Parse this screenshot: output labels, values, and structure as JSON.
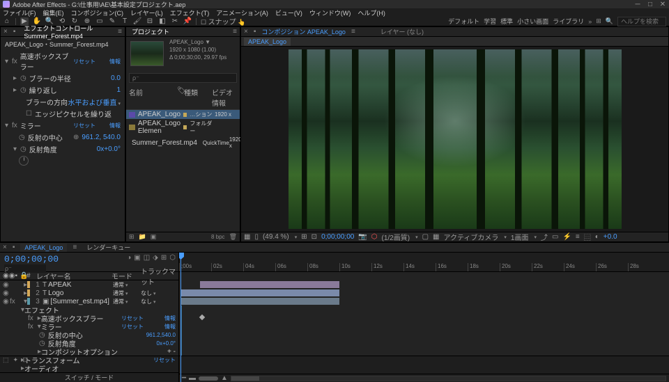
{
  "app": {
    "title": "Adobe After Effects - G:\\仕事用\\AE\\基本設定プロジェクト.aep"
  },
  "menus": [
    "ファイル(F)",
    "編集(E)",
    "コンポジション(C)",
    "レイヤー(L)",
    "エフェクト(T)",
    "アニメーション(A)",
    "ビュー(V)",
    "ウィンドウ(W)",
    "ヘルプ(H)"
  ],
  "toolbar": {
    "snap": "スナップ",
    "workspace_default": "デフォルト",
    "workspace_learn": "学習",
    "workspace_standard": "標準",
    "workspace_small": "小さい画面",
    "workspace_lib": "ライブラリ",
    "search_placeholder": "ヘルプを検索"
  },
  "effects_panel": {
    "tab": "エフェクトコントロール Summer_Forest.mp4",
    "layer": "APEAK_Logo・Summer_Forest.mp4",
    "reset": "リセット",
    "info": "情報",
    "fx1_name": "高速ボックスブラー",
    "fx1_blur_radius_label": "ブラーの半径",
    "fx1_blur_radius_value": "0.0",
    "fx1_iterations_label": "繰り返し",
    "fx1_iterations_value": "1",
    "fx1_direction_label": "ブラーの方向",
    "fx1_direction_value": "水平および垂直",
    "fx1_edge_label": "エッジピクセルを繰り返",
    "fx2_name": "ミラー",
    "fx2_center_label": "反射の中心",
    "fx2_center_value": "961.2, 540.0",
    "fx2_angle_label": "反射角度",
    "fx2_angle_value": "0x+0.0°"
  },
  "project_panel": {
    "tab": "プロジェクト",
    "comp_name": "APEAK_Logo ▼",
    "comp_dims": "1920 x 1080 (1.00)",
    "comp_duration": "Δ 0;00;30;00, 29.97 fps",
    "search_placeholder": "ρ⁻",
    "col_name": "名前",
    "col_type": "種類",
    "col_video": "ビデオ情報",
    "items": [
      {
        "name": "APEAK_Logo",
        "type": "…ション",
        "info": "1920 x"
      },
      {
        "name": "APEAK_Logo Elemen",
        "type": "フォルダー",
        "info": ""
      },
      {
        "name": "Summer_Forest.mp4",
        "type": "QuickTime",
        "info": "1920 x"
      }
    ],
    "bpc": "8 bpc"
  },
  "comp_panel": {
    "tab_comp": "コンポジション APEAK_Logo",
    "tab_layer": "レイヤー (なし)",
    "active_tab": "APEAK_Logo"
  },
  "viewer_footer": {
    "zoom": "(49.4 %)",
    "res_label": "(1/2画質)",
    "time": "0;00;00;00",
    "camera": "アクティブカメラ",
    "views": "1画面",
    "exposure": "+0.0"
  },
  "timeline": {
    "tab_comp": "APEAK_Logo",
    "tab_rq": "レンダーキュー",
    "timecode": "0;00;00;00",
    "search_placeholder": "ρ⁻",
    "col_num": "#",
    "col_layer_name": "レイヤー名",
    "col_mode": "モード",
    "col_trkmat": "トラックマット",
    "mode_normal": "通常",
    "mode_none": "なし",
    "layers": [
      {
        "num": "1",
        "name": "APEAK",
        "color": "#d4a858"
      },
      {
        "num": "2",
        "name": "Logo",
        "color": "#d4a858"
      },
      {
        "num": "3",
        "name": "[Summer_est.mp4]",
        "color": "#5a9aaa"
      }
    ],
    "fx_group": "エフェクト",
    "fx_fast_blur": "高速ボックスブラー",
    "fx_mirror": "ミラー",
    "fx_mirror_center": "反射の中心",
    "fx_mirror_center_val": "961.2,540.0",
    "fx_mirror_angle": "反射角度",
    "fx_mirror_angle_val": "0x+0.0°",
    "comp_options": "コンポジットオプション",
    "comp_options_val": "+ -",
    "transform": "トランスフォーム",
    "audio": "オーディオ",
    "reset": "リセット",
    "info": "情報",
    "switches": "スイッチ / モード",
    "ruler_marks": [
      ";00s",
      "02s",
      "04s",
      "06s",
      "08s",
      "10s",
      "12s",
      "14s",
      "16s",
      "18s",
      "20s",
      "22s",
      "24s",
      "26s",
      "28s"
    ]
  }
}
